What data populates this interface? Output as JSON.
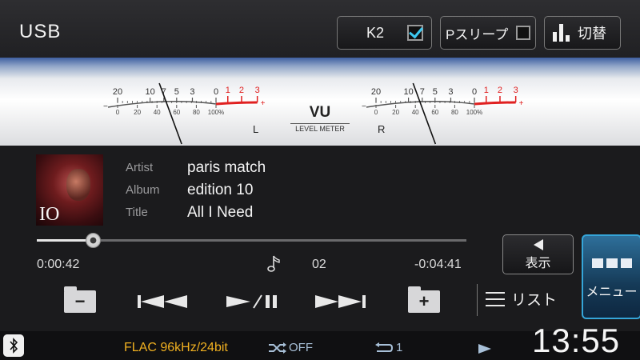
{
  "header": {
    "source": "USB",
    "k2_label": "K2",
    "k2_checked": true,
    "psleep_label": "Pスリープ",
    "psleep_checked": false,
    "switch_label": "切替"
  },
  "meter": {
    "title": "VU",
    "subtitle": "LEVEL METER",
    "left_channel": "L",
    "right_channel": "R",
    "db_scale": [
      "20",
      "10",
      "7",
      "5",
      "3",
      "0"
    ],
    "db_scale_red": [
      "1",
      "2",
      "3"
    ],
    "percent_scale": [
      "0",
      "20",
      "40",
      "60",
      "80",
      "100%"
    ],
    "minus_sign": "−",
    "plus_sign": "+",
    "left_level_db": -8,
    "right_level_db": -9,
    "colors": {
      "red": "#e02020",
      "scale": "#555555",
      "needle": "#111111"
    }
  },
  "track": {
    "artist_label": "Artist",
    "artist": "paris match",
    "album_label": "Album",
    "album": "edition 10",
    "title_label": "Title",
    "title": "All I Need",
    "album_art_text": "IO"
  },
  "playback": {
    "elapsed": "0:00:42",
    "remaining": "-0:04:41",
    "track_number": "02",
    "progress": 0.13
  },
  "controls": {
    "folder_down_symbol": "−",
    "folder_up_symbol": "+",
    "list_label": "リスト",
    "display_label": "表示",
    "menu_label": "メニュー"
  },
  "status": {
    "format": "FLAC 96kHz/24bit",
    "shuffle": "OFF",
    "repeat": "1",
    "clock": "13:55",
    "accent_color": "#f0b020"
  }
}
